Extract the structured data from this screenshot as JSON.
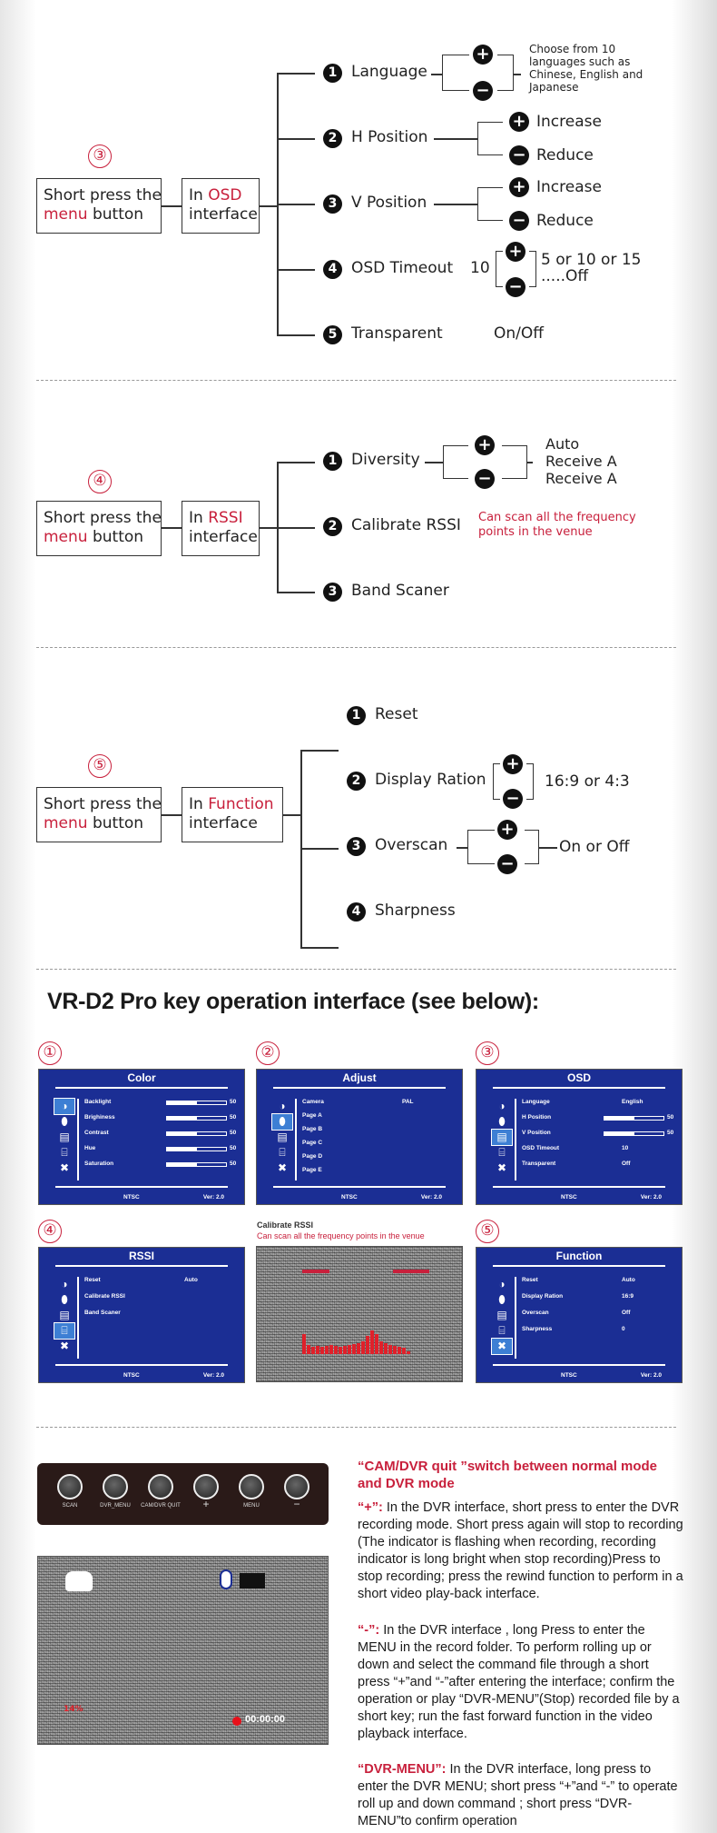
{
  "sections": [
    {
      "step": "③",
      "box1": {
        "line1": "Short press the",
        "red": "menu",
        "rest": " button"
      },
      "box2": {
        "pre": "In ",
        "red": "OSD",
        "line2": "interface"
      },
      "items": [
        {
          "n": "1",
          "label": "Language",
          "note": "Choose from 10 languages such as Chinese, English and Japanese"
        },
        {
          "n": "2",
          "label": "H Position",
          "plus": "Increase",
          "minus": "Reduce"
        },
        {
          "n": "3",
          "label": "V Position",
          "plus": "Increase",
          "minus": "Reduce"
        },
        {
          "n": "4",
          "label": "OSD Timeout",
          "default": "10",
          "options1": "5 or 10 or 15",
          "options2": ".....Off"
        },
        {
          "n": "5",
          "label": "Transparent",
          "value": "On/Off"
        }
      ]
    },
    {
      "step": "④",
      "box1": {
        "line1": "Short press the",
        "red": "menu",
        "rest": " button"
      },
      "box2": {
        "pre": "In ",
        "red": "RSSI",
        "line2": "interface"
      },
      "items": [
        {
          "n": "1",
          "label": "Diversity",
          "opts": [
            "Auto",
            "Receive A",
            "Receive A"
          ]
        },
        {
          "n": "2",
          "label": "Calibrate RSSI",
          "note1": "Can scan all the frequency",
          "note2": "points in the venue"
        },
        {
          "n": "3",
          "label": "Band Scaner"
        }
      ]
    },
    {
      "step": "⑤",
      "box1": {
        "line1": "Short press the",
        "red": "menu",
        "rest": " button"
      },
      "box2": {
        "pre": "In ",
        "red": "Function",
        "line2": "interface"
      },
      "items": [
        {
          "n": "1",
          "label": "Reset"
        },
        {
          "n": "2",
          "label": "Display Ration",
          "value": "16:9 or 4:3"
        },
        {
          "n": "3",
          "label": "Overscan",
          "value": "On or Off"
        },
        {
          "n": "4",
          "label": "Sharpness"
        }
      ]
    }
  ],
  "heading": "VR-D2 Pro key operation interface (see below):",
  "screens": [
    {
      "num": "①",
      "title": "Color",
      "active": 0,
      "rows": [
        {
          "label": "Backlight",
          "bar": 0.5,
          "value": "50"
        },
        {
          "label": "Brighiness",
          "bar": 0.5,
          "value": "50"
        },
        {
          "label": "Contrast",
          "bar": 0.5,
          "value": "50"
        },
        {
          "label": "Hue",
          "bar": 0.5,
          "value": "50"
        },
        {
          "label": "Saturation",
          "bar": 0.5,
          "value": "50"
        }
      ],
      "std": "NTSC",
      "ver": "Ver: 2.0"
    },
    {
      "num": "②",
      "title": "Adjust",
      "active": 1,
      "rows": [
        {
          "label": "Camera",
          "value": "PAL"
        },
        {
          "label": "Page A"
        },
        {
          "label": "Page B"
        },
        {
          "label": "Page C"
        },
        {
          "label": "Page D"
        },
        {
          "label": "Page E"
        }
      ],
      "std": "NTSC",
      "ver": "Ver: 2.0"
    },
    {
      "num": "③",
      "title": "OSD",
      "active": 2,
      "rows": [
        {
          "label": "Language",
          "value": "English"
        },
        {
          "label": "H Position",
          "bar": 0.5,
          "value": "50"
        },
        {
          "label": "V Position",
          "bar": 0.5,
          "value": "50"
        },
        {
          "label": "OSD Timeout",
          "value": "10"
        },
        {
          "label": "Transparent",
          "value": "Off"
        }
      ],
      "std": "NTSC",
      "ver": "Ver: 2.0"
    },
    {
      "num": "④",
      "title": "RSSI",
      "active": 3,
      "rows": [
        {
          "label": "Reset",
          "value": "Auto"
        },
        {
          "label": "Calibrate RSSI"
        },
        {
          "label": "Band Scaner"
        }
      ],
      "std": "NTSC",
      "ver": "Ver: 2.0"
    },
    {
      "num": "⑤",
      "title": "Function",
      "active": 4,
      "rows": [
        {
          "label": "Reset",
          "value": "Auto"
        },
        {
          "label": "Display Ration",
          "value": "16:9"
        },
        {
          "label": "Overscan",
          "value": "Off"
        },
        {
          "label": "Sharpness",
          "value": "0"
        }
      ],
      "std": "NTSC",
      "ver": "Ver: 2.0"
    }
  ],
  "calibrate": {
    "title": "Calibrate RSSI",
    "subtitle": "Can scan all the frequency points in the venue"
  },
  "buttons": [
    "SCAN",
    "DVR_MENU",
    "CAM/DVR QUIT",
    "+",
    "MENU",
    "−"
  ],
  "dvr_screen": {
    "time": "00:00:00",
    "rec_label": "14%"
  },
  "text": {
    "heading": "“CAM/DVR quit ”switch between normal mode and DVR mode",
    "plus_key": "“+”:",
    "plus_text": " In the DVR interface, short press to enter the DVR recording mode. Short press again will stop to recording (The indicator is flashing when recording, recording indicator is long bright when stop recording)Press to stop recording; press the rewind function to perform in a short video play-back interface.",
    "minus_key": "“-”:",
    "minus_text": " In the DVR interface , long Press to enter the MENU in the record folder. To perform rolling up or down and select the command file through a short press “+”and “-”after entering the interface; confirm the operation or play “DVR-MENU”(Stop) recorded file by a short key; run the fast forward function in the video playback interface.",
    "menu_key": "“DVR-MENU”:",
    "menu_text": " In the DVR interface, long press to enter the DVR MENU; short press “+”and “-” to operate roll up and down command ; short press “DVR-MENU”to confirm operation"
  },
  "colors": {
    "accent": "#c8203c",
    "osd_blue": "#1b2e94"
  }
}
